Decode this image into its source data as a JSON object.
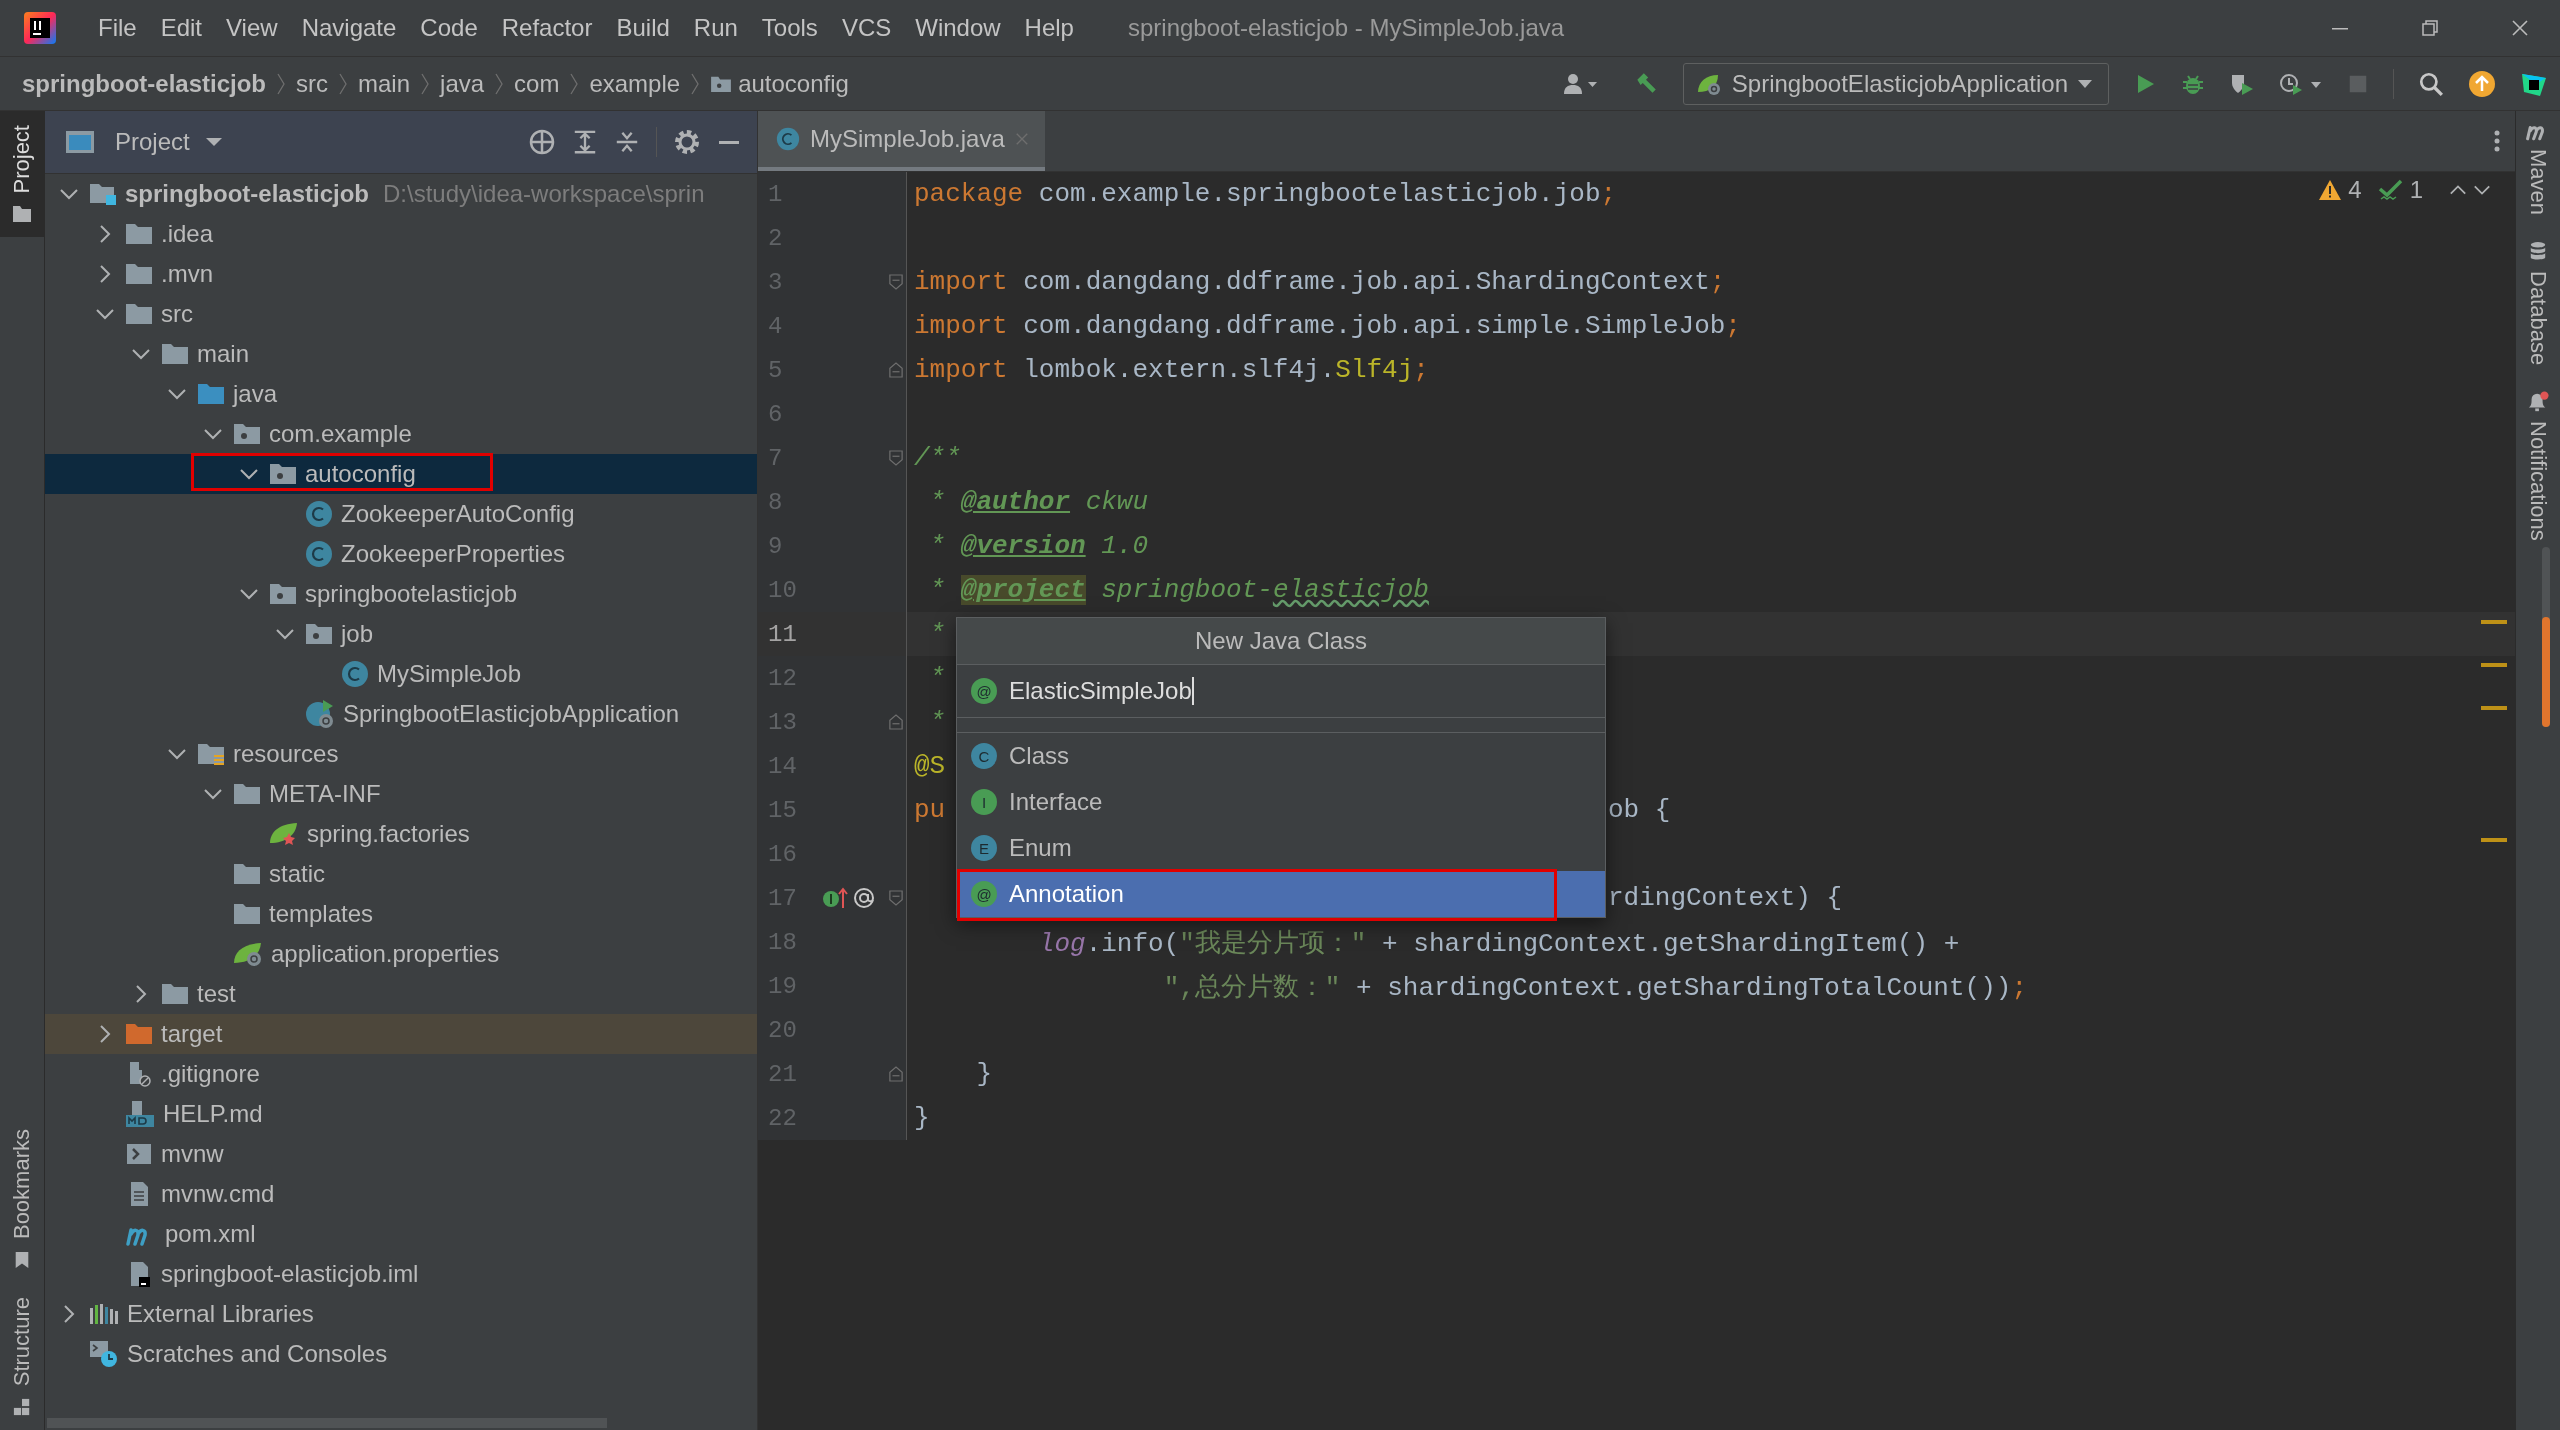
{
  "window": {
    "title": "springboot-elasticjob - MySimpleJob.java"
  },
  "menu": [
    "File",
    "Edit",
    "View",
    "Navigate",
    "Code",
    "Refactor",
    "Build",
    "Run",
    "Tools",
    "VCS",
    "Window",
    "Help"
  ],
  "breadcrumbs": [
    {
      "label": "springboot-elasticjob",
      "kind": "project"
    },
    {
      "label": "src",
      "kind": "folder"
    },
    {
      "label": "main",
      "kind": "folder"
    },
    {
      "label": "java",
      "kind": "folder"
    },
    {
      "label": "com",
      "kind": "folder"
    },
    {
      "label": "example",
      "kind": "folder"
    },
    {
      "label": "autoconfig",
      "kind": "package"
    }
  ],
  "run_config": {
    "label": "SpringbootElasticjobApplication"
  },
  "left_stripe": [
    {
      "label": "Project",
      "selected": true,
      "kind": "project"
    },
    {
      "label": "Bookmarks",
      "selected": false,
      "kind": "bookmarks"
    },
    {
      "label": "Structure",
      "selected": false,
      "kind": "structure"
    }
  ],
  "right_stripe": [
    {
      "label": "Maven",
      "kind": "maven"
    },
    {
      "label": "Database",
      "kind": "database"
    },
    {
      "label": "Notifications",
      "kind": "notifications",
      "unread": true
    }
  ],
  "project": {
    "title": "Project",
    "tree": [
      {
        "label": "springboot-elasticjob",
        "kind": "module",
        "path": "D:\\study\\idea-workspace\\sprin",
        "expanded": true,
        "selected": false,
        "highlighted": false,
        "children": [
          {
            "label": ".idea",
            "kind": "folder",
            "expanded": false,
            "selected": false,
            "highlighted": false
          },
          {
            "label": ".mvn",
            "kind": "folder",
            "expanded": false,
            "selected": false,
            "highlighted": false
          },
          {
            "label": "src",
            "kind": "folder",
            "expanded": true,
            "selected": false,
            "highlighted": false,
            "children": [
              {
                "label": "main",
                "kind": "folder",
                "expanded": true,
                "selected": false,
                "highlighted": false,
                "children": [
                  {
                    "label": "java",
                    "kind": "source-root",
                    "expanded": true,
                    "selected": false,
                    "highlighted": false,
                    "children": [
                      {
                        "label": "com.example",
                        "kind": "package",
                        "expanded": true,
                        "selected": false,
                        "highlighted": false,
                        "children": [
                          {
                            "label": "autoconfig",
                            "kind": "package",
                            "expanded": true,
                            "selected": true,
                            "highlighted": true,
                            "children": [
                              {
                                "label": "ZookeeperAutoConfig",
                                "kind": "class",
                                "selected": false,
                                "highlighted": false
                              },
                              {
                                "label": "ZookeeperProperties",
                                "kind": "class",
                                "selected": false,
                                "highlighted": false
                              }
                            ]
                          },
                          {
                            "label": "springbootelasticjob",
                            "kind": "package",
                            "expanded": true,
                            "selected": false,
                            "highlighted": false,
                            "children": [
                              {
                                "label": "job",
                                "kind": "package",
                                "expanded": true,
                                "selected": false,
                                "highlighted": false,
                                "children": [
                                  {
                                    "label": "MySimpleJob",
                                    "kind": "class",
                                    "selected": false,
                                    "highlighted": false
                                  }
                                ]
                              },
                              {
                                "label": "SpringbootElasticjobApplication",
                                "kind": "boot-class",
                                "selected": false,
                                "highlighted": false
                              }
                            ]
                          }
                        ]
                      }
                    ]
                  },
                  {
                    "label": "resources",
                    "kind": "resources-root",
                    "expanded": true,
                    "selected": false,
                    "highlighted": false,
                    "children": [
                      {
                        "label": "META-INF",
                        "kind": "folder",
                        "expanded": true,
                        "selected": false,
                        "highlighted": false,
                        "children": [
                          {
                            "label": "spring.factories",
                            "kind": "spring-file",
                            "selected": false,
                            "highlighted": false
                          }
                        ]
                      },
                      {
                        "label": "static",
                        "kind": "folder",
                        "selected": false,
                        "highlighted": false
                      },
                      {
                        "label": "templates",
                        "kind": "folder",
                        "selected": false,
                        "highlighted": false
                      },
                      {
                        "label": "application.properties",
                        "kind": "properties",
                        "selected": false,
                        "highlighted": false
                      }
                    ]
                  }
                ]
              },
              {
                "label": "test",
                "kind": "folder",
                "expanded": false,
                "selected": false,
                "highlighted": false
              }
            ]
          },
          {
            "label": "target",
            "kind": "excluded-folder",
            "expanded": false,
            "selected": false,
            "highlighted": false
          },
          {
            "label": ".gitignore",
            "kind": "ignore-file",
            "selected": false,
            "highlighted": false
          },
          {
            "label": "HELP.md",
            "kind": "markdown",
            "selected": false,
            "highlighted": false
          },
          {
            "label": "mvnw",
            "kind": "shell",
            "selected": false,
            "highlighted": false
          },
          {
            "label": "mvnw.cmd",
            "kind": "text-file",
            "selected": false,
            "highlighted": false
          },
          {
            "label": "pom.xml",
            "kind": "maven",
            "selected": false,
            "highlighted": false
          },
          {
            "label": "springboot-elasticjob.iml",
            "kind": "iml",
            "selected": false,
            "highlighted": false
          }
        ]
      },
      {
        "label": "External Libraries",
        "kind": "libraries",
        "expanded": false,
        "selected": false,
        "highlighted": false
      },
      {
        "label": "Scratches and Consoles",
        "kind": "scratches",
        "selected": false,
        "highlighted": false
      }
    ]
  },
  "editor": {
    "tabs": [
      {
        "label": "MySimpleJob.java",
        "selected": true
      }
    ],
    "inspections": {
      "warnings": "4",
      "checks": "1"
    },
    "lines": [
      {
        "number": "1",
        "current": false,
        "code": [
          {
            "kind": "kw",
            "t": "package "
          },
          {
            "kind": "plain",
            "t": "com.example.springbootelasticjob.job"
          },
          {
            "kind": "kw",
            "t": ";"
          }
        ]
      },
      {
        "number": "2",
        "current": false
      },
      {
        "number": "3",
        "current": false,
        "fold_start": true,
        "code": [
          {
            "kind": "kw",
            "t": "import "
          },
          {
            "kind": "plain",
            "t": "com.dangdang.ddframe.job.api.ShardingContext"
          },
          {
            "kind": "kw",
            "t": ";"
          }
        ]
      },
      {
        "number": "4",
        "current": false,
        "code": [
          {
            "kind": "kw",
            "t": "import "
          },
          {
            "kind": "plain",
            "t": "com.dangdang.ddframe.job.api.simple.SimpleJob"
          },
          {
            "kind": "kw",
            "t": ";"
          }
        ]
      },
      {
        "number": "5",
        "current": false,
        "fold_end": true,
        "code": [
          {
            "kind": "kw",
            "t": "import "
          },
          {
            "kind": "plain",
            "t": "lombok.extern.slf4j."
          },
          {
            "kind": "ann",
            "t": "Slf4j"
          },
          {
            "kind": "kw",
            "t": ";"
          }
        ]
      },
      {
        "number": "6",
        "current": false
      },
      {
        "number": "7",
        "current": false,
        "fold_start": true,
        "code": [
          {
            "kind": "doc",
            "t": "/**"
          }
        ]
      },
      {
        "number": "8",
        "current": false,
        "code": [
          {
            "kind": "doc",
            "t": " * "
          },
          {
            "kind": "doctag",
            "t": "@author"
          },
          {
            "kind": "doc",
            "t": " ckwu"
          }
        ]
      },
      {
        "number": "9",
        "current": false,
        "code": [
          {
            "kind": "doc",
            "t": " * "
          },
          {
            "kind": "doctag",
            "t": "@version"
          },
          {
            "kind": "doc",
            "t": " 1.0"
          }
        ]
      },
      {
        "number": "10",
        "current": false,
        "code": [
          {
            "kind": "doc",
            "t": " * "
          },
          {
            "kind": "doctag-marked",
            "t": "@project"
          },
          {
            "kind": "doc",
            "t": " springboot-"
          },
          {
            "kind": "typo",
            "t": "elasticjob"
          }
        ]
      },
      {
        "number": "11",
        "current": true,
        "code": [
          {
            "kind": "doc",
            "t": " *"
          }
        ]
      },
      {
        "number": "12",
        "current": false,
        "code": [
          {
            "kind": "doc",
            "t": " *"
          }
        ]
      },
      {
        "number": "13",
        "current": false,
        "fold_end": true,
        "code": [
          {
            "kind": "doc",
            "t": " *"
          }
        ]
      },
      {
        "number": "14",
        "current": false,
        "code": [
          {
            "kind": "ann",
            "t": "@S"
          }
        ]
      },
      {
        "number": "15",
        "current": false,
        "code": [
          {
            "kind": "kw",
            "t": "pu"
          }
        ],
        "code_right": [
          {
            "kind": "plain",
            "t": "ob {"
          }
        ]
      },
      {
        "number": "16",
        "current": false
      },
      {
        "number": "17",
        "current": false,
        "fold_start": true,
        "gutter_marks": true,
        "code_right": [
          {
            "kind": "plain",
            "t": "rdingContext) {"
          }
        ]
      },
      {
        "number": "18",
        "current": false,
        "code": [
          {
            "kind": "static",
            "t": "        log"
          },
          {
            "kind": "plain",
            "t": ".info("
          },
          {
            "kind": "str",
            "t": "\"我是分片项：\""
          },
          {
            "kind": "plain",
            "t": " + shardingContext.getShardingItem() +"
          }
        ]
      },
      {
        "number": "19",
        "current": false,
        "code": [
          {
            "kind": "str",
            "t": "                \",总分片数：\""
          },
          {
            "kind": "plain",
            "t": " + shardingContext.getShardingTotalCount())"
          },
          {
            "kind": "kw",
            "t": ";"
          }
        ]
      },
      {
        "number": "20",
        "current": false
      },
      {
        "number": "21",
        "current": false,
        "fold_end": true,
        "code": [
          {
            "kind": "plain",
            "t": "    }"
          }
        ]
      },
      {
        "number": "22",
        "current": false,
        "code": [
          {
            "kind": "plain",
            "t": "}"
          }
        ]
      }
    ]
  },
  "popup": {
    "title": "New Java Class",
    "icon_letter": "@",
    "value": "ElasticSimpleJob",
    "items": [
      {
        "label": "Class",
        "icon_letter": "C",
        "color": "#3e86a0",
        "selected": false,
        "highlighted": false
      },
      {
        "label": "Interface",
        "icon_letter": "I",
        "color": "#499c54",
        "selected": false,
        "highlighted": false
      },
      {
        "label": "Enum",
        "icon_letter": "E",
        "color": "#3e86a0",
        "selected": false,
        "highlighted": false
      },
      {
        "label": "Annotation",
        "icon_letter": "@",
        "color": "#499c54",
        "selected": true,
        "highlighted": true
      }
    ]
  }
}
